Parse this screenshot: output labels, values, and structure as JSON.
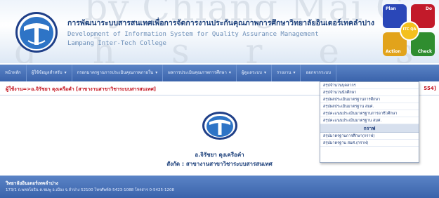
{
  "header": {
    "watermark_line1": "by Chiang Mai C",
    "watermark_line2": "g h s r e s e",
    "title_th": "การพัฒนาระบบสารสนเทศเพื่อการจัดการงานประกันคุณภาพการศึกษาวิทยาลัยอินเตอร์เทคลำปาง",
    "title_en_1": "Development of Information System for Quality Assurance Management",
    "title_en_2": "Lampang Inter-Tech College",
    "pdca": {
      "plan": "Plan",
      "do": "Do",
      "action": "Action",
      "check": "Check",
      "center": "ITC QA"
    }
  },
  "nav": {
    "items": [
      {
        "label": "หน้าหลัก",
        "has_menu": false
      },
      {
        "label": "ผู้ใช้ข้อมูลสำหรับ",
        "has_menu": true
      },
      {
        "label": "กรอกมาตรฐานการประเมินคุณภาพภายใน",
        "has_menu": true
      },
      {
        "label": "ผลการประเมินคุณภาพการศึกษา",
        "has_menu": true
      },
      {
        "label": "ผู้ดูแลระบบ",
        "has_menu": true
      },
      {
        "label": "รายงาน",
        "has_menu": true
      },
      {
        "label": "ออกจากระบบ",
        "has_menu": false
      }
    ]
  },
  "breadcrumb": {
    "text": "ผู้ใช้งาน=>อ.จิรัชยา ดุงเครือคำ [สาขางานสาขาวิชาระบบสารสนเทศ]",
    "right_text": "554]"
  },
  "dropdown": {
    "items_top": [
      "สรุปจำนวนบุคลากร",
      "สรุปจำนวนนักศึกษา",
      "สรุปผลประเมินมาตรฐานการศึกษา",
      "สรุปผลประเมินมาตรฐาน สมศ.",
      "สรุปคะแนนประเมินมาตรฐานการอาชีวศึกษา",
      "สรุปคะแนนประเมินมาตรฐาน สมศ."
    ],
    "section_header": "กราฟ",
    "items_bottom": [
      "สรุปมาตรฐานการศึกษา(กราฟ)",
      "สรุปมาตรฐาน สมศ.(กราฟ)"
    ]
  },
  "content": {
    "user_name": "อ.จิรัชยา ดุงเครือคำ",
    "affiliation": "สังกัด : สาขางานสาขาวิชาระบบสารสนเทศ"
  },
  "footer": {
    "college_name": "วิทยาลัยอินเตอร์เทคลำปาง",
    "address": "173/1 ถ.พหลโยธิน ต.ชมพู อ.เมือง จ.ลำปาง 52100 โทรศัพท์0-5423-1088 โทรสาร 0-5425-1208"
  },
  "colors": {
    "nav_bg": "#3a63ab",
    "title_blue": "#1b3f7a",
    "crumb_red": "#c3131e"
  }
}
